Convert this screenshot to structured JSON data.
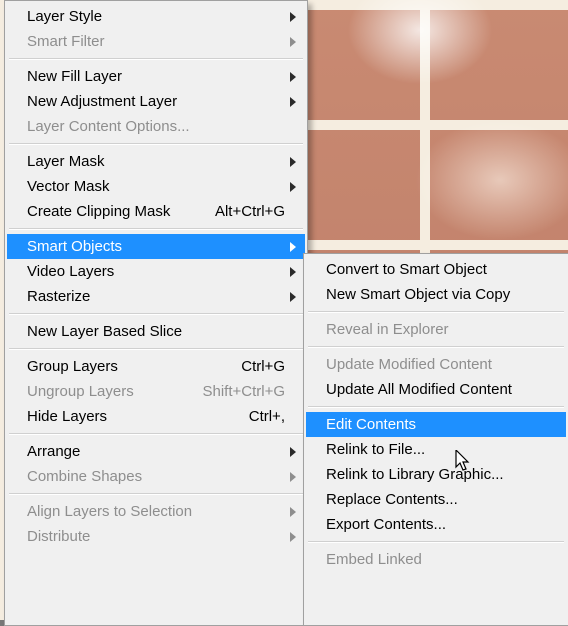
{
  "main_menu": {
    "layer_style": "Layer Style",
    "smart_filter": "Smart Filter",
    "new_fill_layer": "New Fill Layer",
    "new_adjustment_layer": "New Adjustment Layer",
    "layer_content_options": "Layer Content Options...",
    "layer_mask": "Layer Mask",
    "vector_mask": "Vector Mask",
    "create_clipping_mask": "Create Clipping Mask",
    "create_clipping_mask_sc": "Alt+Ctrl+G",
    "smart_objects": "Smart Objects",
    "video_layers": "Video Layers",
    "rasterize": "Rasterize",
    "new_layer_based_slice": "New Layer Based Slice",
    "group_layers": "Group Layers",
    "group_layers_sc": "Ctrl+G",
    "ungroup_layers": "Ungroup Layers",
    "ungroup_layers_sc": "Shift+Ctrl+G",
    "hide_layers": "Hide Layers",
    "hide_layers_sc": "Ctrl+,",
    "arrange": "Arrange",
    "combine_shapes": "Combine Shapes",
    "align_layers_to_selection": "Align Layers to Selection",
    "distribute": "Distribute"
  },
  "submenu": {
    "convert_to_smart_object": "Convert to Smart Object",
    "new_smart_object_via_copy": "New Smart Object via Copy",
    "reveal_in_explorer": "Reveal in Explorer",
    "update_modified_content": "Update Modified Content",
    "update_all_modified_content": "Update All Modified Content",
    "edit_contents": "Edit Contents",
    "relink_to_file": "Relink to File...",
    "relink_to_library_graphic": "Relink to Library Graphic...",
    "replace_contents": "Replace Contents...",
    "export_contents": "Export Contents...",
    "embed_linked": "Embed Linked"
  }
}
